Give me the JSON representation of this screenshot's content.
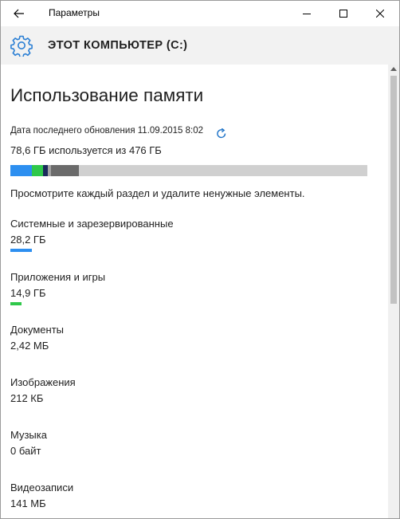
{
  "window": {
    "title": "Параметры"
  },
  "header": {
    "title": "ЭТОТ КОМПЬЮТЕР (C:)"
  },
  "page": {
    "title": "Использование памяти",
    "updated": "Дата последнего обновления 11.09.2015 8:02",
    "used": "78,6 ГБ используется из 476 ГБ",
    "hint": "Просмотрите каждый раздел и удалите ненужные элементы."
  },
  "storage_bar": {
    "total_gb": 476,
    "segments": [
      {
        "fraction": 0.0592,
        "color": "#2d8ff0"
      },
      {
        "fraction": 0.0313,
        "color": "#2fc84a"
      },
      {
        "fraction": 0.0134,
        "color": "#1b2a5b"
      },
      {
        "fraction": 0.0082,
        "color": "#a3a3a3"
      },
      {
        "fraction": 0.0774,
        "color": "#6b6b6b"
      }
    ],
    "track_color": "#d0d0d0"
  },
  "categories": [
    {
      "name": "Системные и зарезервированные",
      "size": "28,2 ГБ",
      "bar_fraction": 0.0592,
      "bar_color": "#2d8ff0"
    },
    {
      "name": "Приложения и игры",
      "size": "14,9 ГБ",
      "bar_fraction": 0.0313,
      "bar_color": "#2fc84a"
    },
    {
      "name": "Документы",
      "size": "2,42 МБ"
    },
    {
      "name": "Изображения",
      "size": "212 КБ"
    },
    {
      "name": "Музыка",
      "size": "0 байт"
    },
    {
      "name": "Видеозаписи",
      "size": "141 МБ"
    }
  ],
  "icons": {
    "back": "back-arrow-icon",
    "minimize": "minimize-icon",
    "maximize": "maximize-icon",
    "close": "close-icon",
    "settings": "gear-icon",
    "refresh": "refresh-icon"
  },
  "colors": {
    "accent": "#2d8ff0",
    "header_bg": "#f2f2f2",
    "refresh": "#1e73c8"
  }
}
